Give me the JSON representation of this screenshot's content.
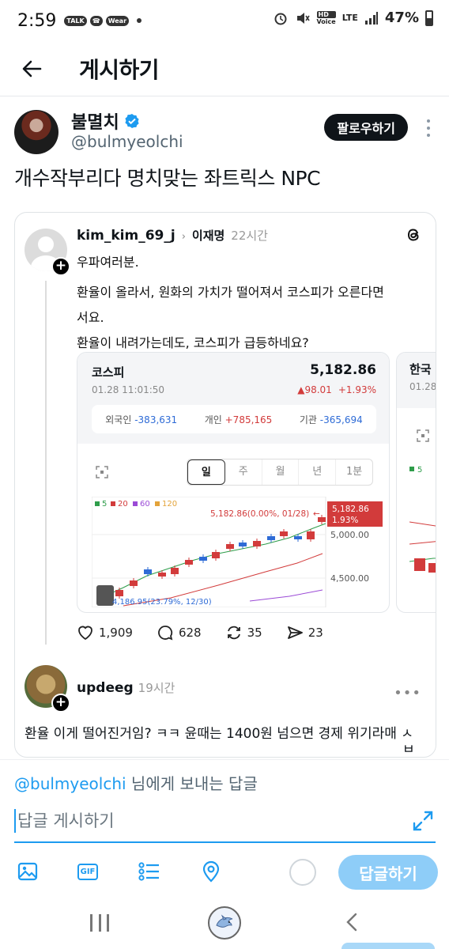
{
  "status_bar": {
    "time": "2:59",
    "left_badges": [
      "TALK",
      "☎",
      "Wear"
    ],
    "net_label": "HD",
    "net_sublabel": "Voice",
    "lte_label": "LTE",
    "battery": "47%"
  },
  "header": {
    "title": "게시하기"
  },
  "author": {
    "name": "불멸치",
    "handle": "@bulmyeolchi",
    "follow_label": "팔로우하기"
  },
  "tweet": {
    "text": "개수작부리다 명치맞는 좌트릭스 NPC"
  },
  "embed": {
    "user": "kim_kim_69_j",
    "chevron": "›",
    "tag": "이재명",
    "time": "22시간",
    "lines": [
      "우파여러분.",
      "환율이 올라서, 원화의 가치가 떨어져서 코스피가 오른다면",
      "서요.",
      "환율이 내려가는데도, 코스피가 급등하네요?"
    ],
    "stock": {
      "name": "코스피",
      "datetime": "01.28 11:01:50",
      "price": "5,182.86",
      "change": "▲98.01",
      "change_pct": "+1.93%",
      "investors": [
        {
          "label": "외국인",
          "value": "-383,631",
          "sign": "neg"
        },
        {
          "label": "개인",
          "value": "+785,165",
          "sign": "pos"
        },
        {
          "label": "기관",
          "value": "-365,694",
          "sign": "neg"
        }
      ],
      "period_tabs": [
        "일",
        "주",
        "월",
        "년",
        "1분"
      ],
      "active_tab": "일",
      "ma_legend": [
        {
          "label": "5",
          "color": "#2e9d4a"
        },
        {
          "label": "20",
          "color": "#d23b3b"
        },
        {
          "label": "60",
          "color": "#9b4ad6"
        },
        {
          "label": "120",
          "color": "#e3a33a"
        }
      ],
      "high_annotation": "5,182.86(0.00%, 01/28)",
      "arrow_glyph": "←",
      "low_annotation": "4,186.95(23.79%, 12/30)",
      "price_tag": "5,182.86",
      "price_tag_pct": "1.93%",
      "price_tag_color": "#d23b3b",
      "y_ticks": [
        "5,000.00",
        "4,500.00"
      ]
    },
    "next_card": {
      "name": "한국",
      "date": "01.28",
      "legend": "5"
    },
    "actions": {
      "likes": "1,909",
      "comments": "628",
      "reposts": "35",
      "shares": "23"
    },
    "reply": {
      "user": "updeeg",
      "time": "19시간",
      "text": "환율 이게 떨어진거임? ㅋㅋ 윤때는 1400원 넘으면 경제 위기라매 ㅅ",
      "text_overflow": "ㅂ"
    }
  },
  "composer": {
    "mention": "@bulmyeolchi",
    "reply_to_suffix": " 님에게 보내는 답글",
    "placeholder": "답글 게시하기",
    "reply_button": "답글하기",
    "gif_label": "GIF",
    "accent": "#1d9bf0"
  },
  "colors": {
    "up": "#d23b3b",
    "down": "#2e6bd6",
    "accent": "#1d9bf0"
  }
}
